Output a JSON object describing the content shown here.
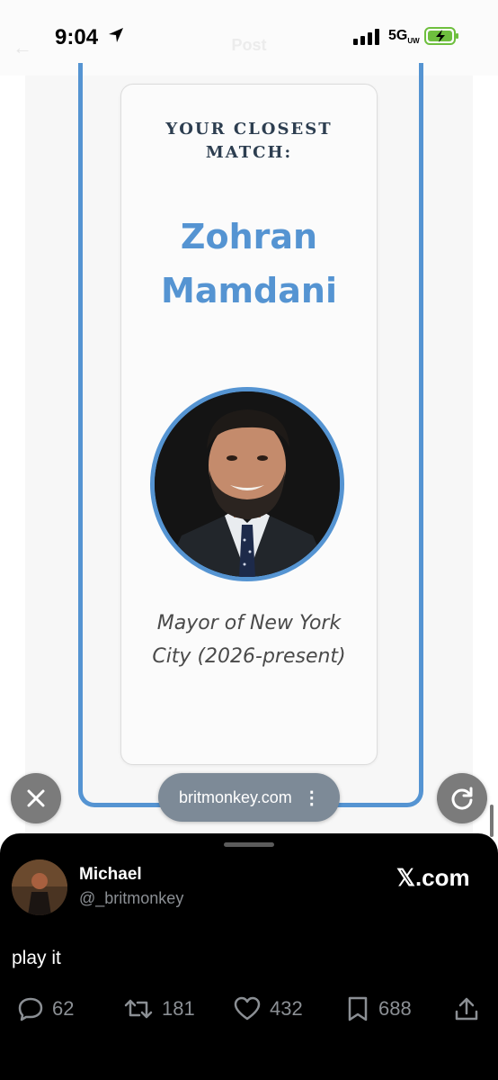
{
  "status_bar": {
    "time": "9:04",
    "network": "5G",
    "network_sub": "UW"
  },
  "ghost_header": {
    "title": "Post"
  },
  "card": {
    "label": "YOUR CLOSEST MATCH:",
    "name_line1": "Zohran",
    "name_line2": "Mamdani",
    "role": "Mayor of New York City (2026-present)"
  },
  "browser": {
    "url": "britmonkey.com",
    "menu_icon": "more-vertical-icon"
  },
  "post": {
    "author": "Michael",
    "handle": "@_britmonkey",
    "brand": "𝕏.com",
    "text": "play it",
    "replies": "62",
    "reposts": "181",
    "likes": "432",
    "bookmarks": "688"
  },
  "colors": {
    "accent": "#5594d2",
    "sheet_bg": "#000000",
    "muted": "#8b8f94"
  }
}
